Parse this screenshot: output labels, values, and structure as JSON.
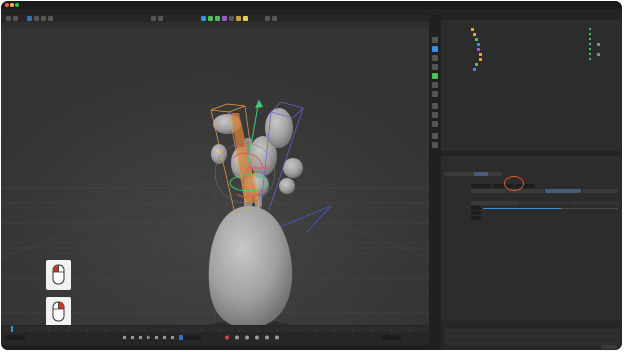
{
  "window": {
    "title": "",
    "traffic_colors": [
      "#ff5f57",
      "#febc2e",
      "#28c840"
    ]
  },
  "layouts": {
    "items": [
      "",
      "",
      "",
      "",
      "",
      "",
      ""
    ],
    "active_index": 0
  },
  "menu": {
    "items": [
      "",
      "",
      "",
      "",
      "",
      "",
      "",
      "",
      "",
      "",
      "",
      "",
      "",
      "",
      "",
      "",
      "",
      "",
      ""
    ]
  },
  "viewport": {
    "menu_items": [
      "",
      "",
      "",
      "",
      "",
      "",
      "",
      "",
      "",
      "",
      ""
    ],
    "camera_label": "",
    "grid_spacing": ""
  },
  "objects_panel": {
    "tabs": [
      "",
      ""
    ],
    "menu_items": [
      "",
      "",
      "",
      "",
      "",
      "",
      ""
    ],
    "rows": [
      {
        "name": "",
        "selected": false
      },
      {
        "name": "",
        "selected": true
      },
      {
        "name": "",
        "selected": false
      },
      {
        "name": "",
        "selected": false
      },
      {
        "name": "",
        "selected": false
      },
      {
        "name": "",
        "selected": false
      },
      {
        "name": "",
        "selected": false
      },
      {
        "name": "",
        "selected": false
      },
      {
        "name": "",
        "selected": false
      }
    ]
  },
  "attributes": {
    "tabs": [
      "",
      ""
    ],
    "menu_items": [
      "",
      "",
      "",
      ""
    ],
    "object_title": "",
    "sub_tabs": [
      "",
      "",
      "",
      ""
    ],
    "active_sub_tab": 2,
    "section_title": "",
    "fields": [
      {
        "label": "",
        "values": [
          "",
          "",
          ""
        ]
      },
      {
        "label": "",
        "values": [
          "",
          "",
          "",
          ""
        ]
      }
    ],
    "subsection": "",
    "subfields": [
      {
        "label": "",
        "options": [
          "",
          "",
          ""
        ]
      },
      {
        "label": "",
        "value": ""
      },
      {
        "label": "",
        "value": ""
      },
      {
        "label": "",
        "value": ""
      }
    ]
  },
  "coordinates": {
    "header": [
      "",
      ""
    ],
    "rows": [
      {
        "label": "",
        "v1": "",
        "v2": ""
      },
      {
        "label": "",
        "v1": "",
        "v2": ""
      },
      {
        "label": "",
        "v1": "",
        "v2": ""
      }
    ],
    "apply_label": ""
  },
  "timeline": {
    "start_frame": "",
    "current_frame": "",
    "end_frame": "",
    "ticks": [
      "",
      "",
      "",
      "",
      "",
      "",
      "",
      "",
      "",
      "",
      "",
      "",
      "",
      "",
      "",
      "",
      "",
      "",
      "",
      "",
      "",
      ""
    ]
  },
  "status_text": "",
  "colors": {
    "accent": "#e05a2a",
    "selection_orange": "#f0a040",
    "tool_blue": "#3a8ee0",
    "tool_green": "#4cc05a",
    "mesh_gray": "#a6a6a6"
  },
  "icons": [
    "move-tool-icon",
    "rotate-tool-icon",
    "scale-tool-icon",
    "camera-icon",
    "light-icon",
    "mouse-left-click-icon",
    "mouse-right-click-icon",
    "play-icon",
    "record-icon",
    "keyframe-icon"
  ]
}
